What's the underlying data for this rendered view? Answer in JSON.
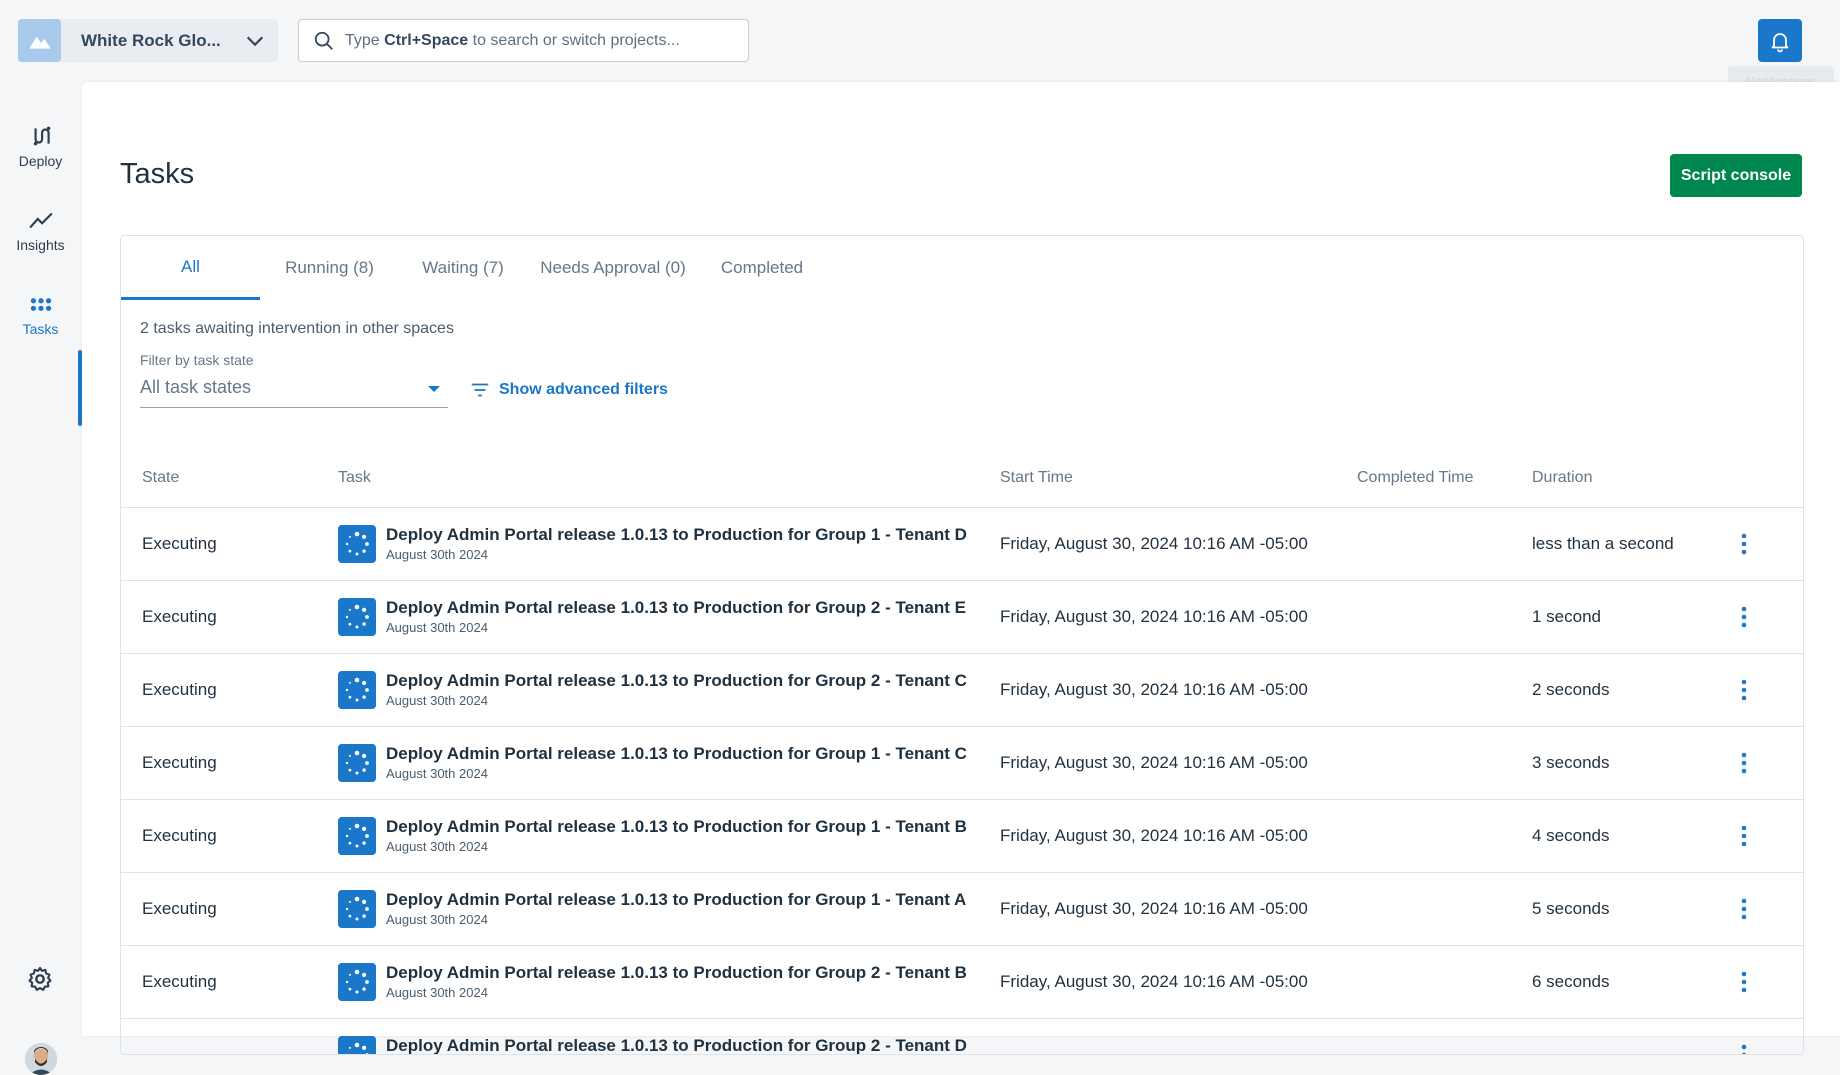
{
  "header": {
    "space_name": "White Rock Glo...",
    "search_prefix": "Type ",
    "search_shortcut": "Ctrl+Space",
    "search_suffix": " to search or switch projects...",
    "bell_tooltip": "Notifications"
  },
  "nav": {
    "items": [
      {
        "label": "Deploy",
        "icon": "deploy-icon"
      },
      {
        "label": "Insights",
        "icon": "insights-icon"
      },
      {
        "label": "Tasks",
        "icon": "tasks-icon",
        "active": true
      }
    ]
  },
  "page": {
    "title": "Tasks",
    "script_console_label": "Script console"
  },
  "tabs": [
    {
      "label": "All",
      "active": true
    },
    {
      "label": "Running (8)"
    },
    {
      "label": "Waiting (7)"
    },
    {
      "label": "Needs Approval (0)"
    },
    {
      "label": "Completed"
    }
  ],
  "intervention_text": "2 tasks awaiting intervention in other spaces",
  "filter": {
    "label": "Filter by task state",
    "value": "All task states",
    "advanced_label": "Show advanced filters"
  },
  "table": {
    "columns": [
      "State",
      "Task",
      "Start Time",
      "Completed Time",
      "Duration"
    ],
    "rows": [
      {
        "state": "Executing",
        "task": "Deploy Admin Portal release 1.0.13 to Production for Group 1 - Tenant D",
        "date": "August 30th 2024",
        "start": "Friday, August 30, 2024 10:16 AM -05:00",
        "completed": "",
        "duration": "less than a second"
      },
      {
        "state": "Executing",
        "task": "Deploy Admin Portal release 1.0.13 to Production for Group 2 - Tenant E",
        "date": "August 30th 2024",
        "start": "Friday, August 30, 2024 10:16 AM -05:00",
        "completed": "",
        "duration": "1 second"
      },
      {
        "state": "Executing",
        "task": "Deploy Admin Portal release 1.0.13 to Production for Group 2 - Tenant C",
        "date": "August 30th 2024",
        "start": "Friday, August 30, 2024 10:16 AM -05:00",
        "completed": "",
        "duration": "2 seconds"
      },
      {
        "state": "Executing",
        "task": "Deploy Admin Portal release 1.0.13 to Production for Group 1 - Tenant C",
        "date": "August 30th 2024",
        "start": "Friday, August 30, 2024 10:16 AM -05:00",
        "completed": "",
        "duration": "3 seconds"
      },
      {
        "state": "Executing",
        "task": "Deploy Admin Portal release 1.0.13 to Production for Group 1 - Tenant B",
        "date": "August 30th 2024",
        "start": "Friday, August 30, 2024 10:16 AM -05:00",
        "completed": "",
        "duration": "4 seconds"
      },
      {
        "state": "Executing",
        "task": "Deploy Admin Portal release 1.0.13 to Production for Group 1 - Tenant A",
        "date": "August 30th 2024",
        "start": "Friday, August 30, 2024 10:16 AM -05:00",
        "completed": "",
        "duration": "5 seconds"
      },
      {
        "state": "Executing",
        "task": "Deploy Admin Portal release 1.0.13 to Production for Group 2 - Tenant B",
        "date": "August 30th 2024",
        "start": "Friday, August 30, 2024 10:16 AM -05:00",
        "completed": "",
        "duration": "6 seconds"
      },
      {
        "state": "",
        "task": "Deploy Admin Portal release 1.0.13 to Production for Group 2 - Tenant D",
        "date": "",
        "start": "",
        "completed": "",
        "duration": ""
      }
    ]
  },
  "colors": {
    "accent": "#1a77ca",
    "primary_button": "#00874d"
  }
}
